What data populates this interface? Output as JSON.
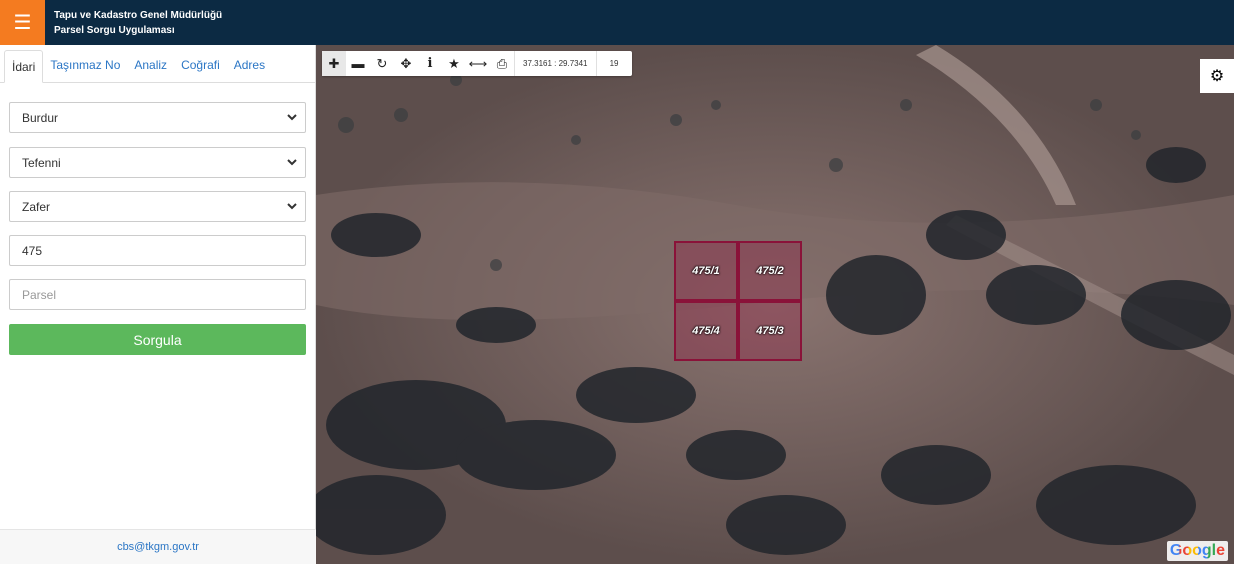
{
  "header": {
    "menu_icon": "hamburger-icon",
    "title_line1": "Tapu ve Kadastro Genel Müdürlüğü",
    "title_line2": "Parsel Sorgu Uygulaması"
  },
  "tabs": [
    {
      "label": "İdari",
      "active": true
    },
    {
      "label": "Taşınmaz No",
      "active": false
    },
    {
      "label": "Analiz",
      "active": false
    },
    {
      "label": "Coğrafi",
      "active": false
    },
    {
      "label": "Adres",
      "active": false
    }
  ],
  "form": {
    "province": "Burdur",
    "district": "Tefenni",
    "neighborhood": "Zafer",
    "block_value": "475",
    "parcel_placeholder": "Parsel",
    "query_label": "Sorgula"
  },
  "footer": {
    "email": "cbs@tkgm.gov.tr"
  },
  "map_toolbar": {
    "tools": [
      "zoom-in-icon",
      "zoom-out-icon",
      "refresh-icon",
      "locate-icon",
      "info-icon",
      "favorite-icon",
      "measure-icon",
      "print-icon"
    ],
    "coordinates": "37.3161 : 29.7341",
    "zoom_level": "19"
  },
  "map": {
    "parcels": [
      "475/1",
      "475/2",
      "475/4",
      "475/3"
    ],
    "attribution": "Google",
    "colors": {
      "parcel_border": "#8a1239",
      "accent": "#f47b20",
      "header_bg": "#0c2a43",
      "button": "#5cb85c"
    }
  }
}
